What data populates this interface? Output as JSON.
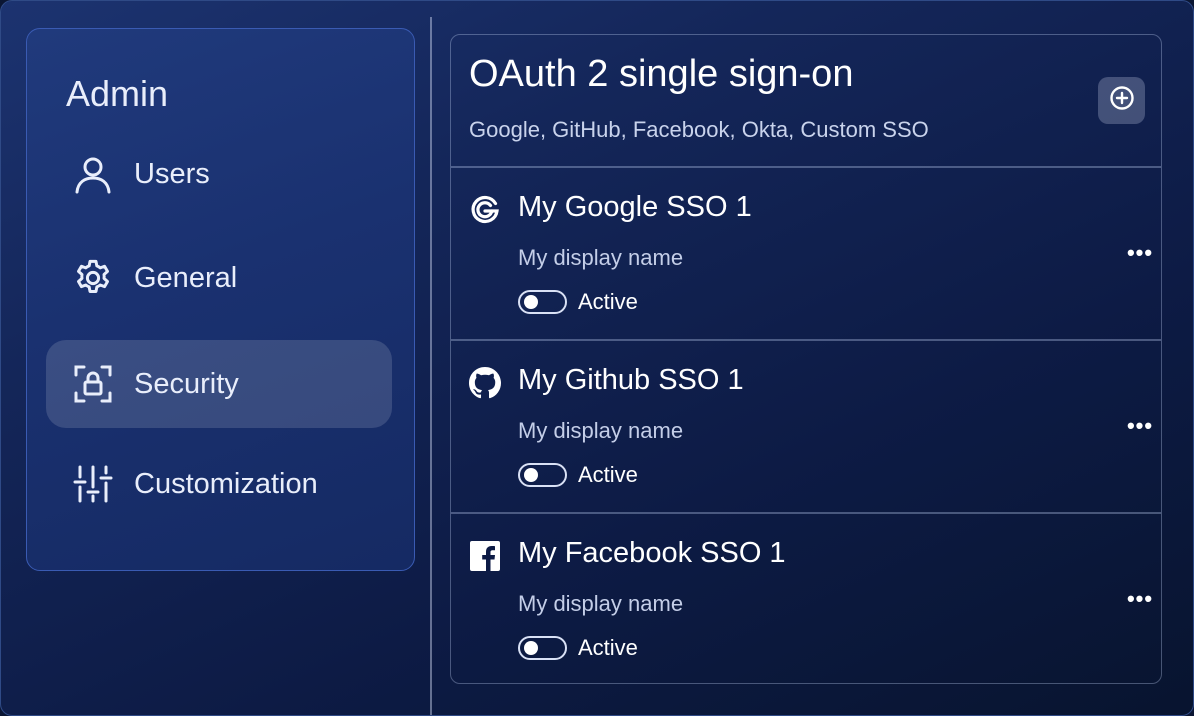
{
  "sidebar": {
    "title": "Admin",
    "items": [
      {
        "label": "Users",
        "icon": "user-icon"
      },
      {
        "label": "General",
        "icon": "gear-icon"
      },
      {
        "label": "Security",
        "icon": "shield-lock-icon",
        "active": true
      },
      {
        "label": "Customization",
        "icon": "sliders-icon"
      }
    ]
  },
  "panel": {
    "title": "OAuth 2 single sign-on",
    "subtitle": "Google, GitHub, Facebook, Okta, Custom SSO",
    "add_icon": "plus-circle-icon"
  },
  "sso_items": [
    {
      "name": "My Google SSO 1",
      "icon": "google-icon",
      "display_name": "My display name",
      "status_label": "Active",
      "active": false
    },
    {
      "name": "My Github SSO 1",
      "icon": "github-icon",
      "display_name": "My display name",
      "status_label": "Active",
      "active": false
    },
    {
      "name": "My Facebook SSO 1",
      "icon": "facebook-icon",
      "display_name": "My display name",
      "status_label": "Active",
      "active": false
    }
  ],
  "more_icon_glyph": "•••",
  "colors": {
    "background": "#0b1633",
    "sidebar_border": "#3a5bb3",
    "text_primary": "#ffffff",
    "text_secondary": "#c4cee8"
  }
}
